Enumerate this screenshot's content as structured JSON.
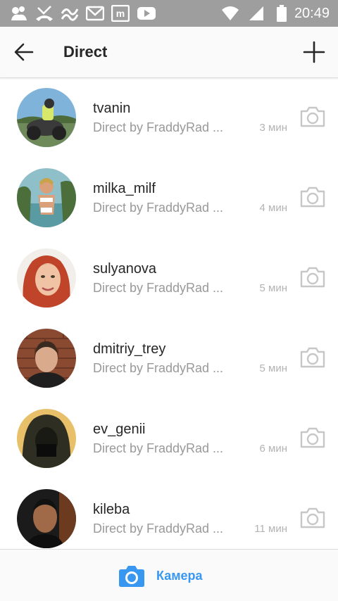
{
  "status_bar": {
    "time": "20:49",
    "left_icons": [
      "notification-app-icon",
      "missed-call-icon",
      "signal-wave-icon",
      "gmail-icon",
      "m-app-icon",
      "youtube-icon"
    ],
    "right_icons": [
      "wifi-icon",
      "cell-signal-icon",
      "battery-icon"
    ]
  },
  "header": {
    "title": "Direct",
    "back_icon": "arrow-left-icon",
    "new_icon": "plus-icon"
  },
  "threads": [
    {
      "username": "tvanin",
      "preview": "Direct by FraddyRad ...",
      "time": "3 мин"
    },
    {
      "username": "milka_milf",
      "preview": "Direct by FraddyRad ...",
      "time": "4 мин"
    },
    {
      "username": "sulyanova",
      "preview": "Direct by FraddyRad ...",
      "time": "5 мин"
    },
    {
      "username": "dmitriy_trey",
      "preview": "Direct by FraddyRad ...",
      "time": "5 мин"
    },
    {
      "username": "ev_genii",
      "preview": "Direct by FraddyRad ...",
      "time": "6 мин"
    },
    {
      "username": "kileba",
      "preview": "Direct by FraddyRad ...",
      "time": "11 мин"
    }
  ],
  "bottom_bar": {
    "camera_label": "Камера",
    "accent_color": "#3897f0"
  }
}
